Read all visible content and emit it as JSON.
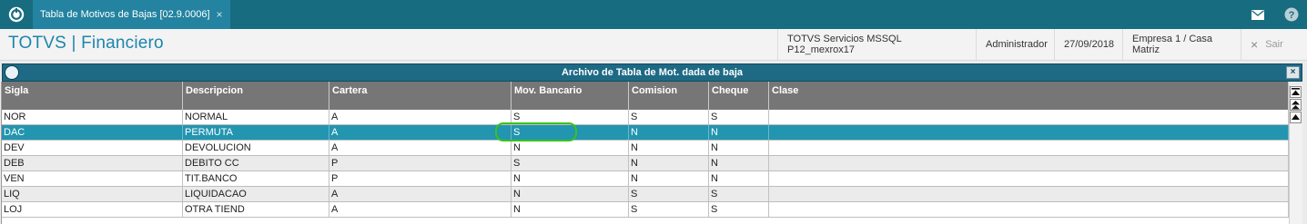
{
  "topbar": {
    "tab_label": "Tabla de Motivos de Bajas [02.9.0006]",
    "tab_close": "×",
    "icons": [
      "app-logo-icon",
      "mail-icon",
      "help-icon"
    ]
  },
  "header": {
    "app_title": "TOTVS | Financiero",
    "server": "TOTVS Servicios MSSQL P12_mexrox17",
    "user": "Administrador",
    "date": "27/09/2018",
    "company": "Empresa 1 / Casa Matriz",
    "exit_icon": "×",
    "exit_label": "Sair"
  },
  "dialog": {
    "title": "Archivo de Tabla de Mot. dada de baja",
    "close_label": "×"
  },
  "grid": {
    "columns": [
      "Sigla",
      "Descripcion",
      "Cartera",
      "Mov. Bancario",
      "Comision",
      "Cheque",
      "Clase"
    ],
    "rows": [
      {
        "cells": [
          "NOR",
          "NORMAL",
          "A",
          "S",
          "S",
          "S",
          ""
        ]
      },
      {
        "cells": [
          "DAC",
          "PERMUTA",
          "A",
          "S",
          "N",
          "N",
          ""
        ]
      },
      {
        "cells": [
          "DEV",
          "DEVOLUCION",
          "A",
          "N",
          "N",
          "N",
          ""
        ]
      },
      {
        "cells": [
          "DEB",
          "DEBITO CC",
          "P",
          "S",
          "N",
          "N",
          ""
        ]
      },
      {
        "cells": [
          "VEN",
          "TIT.BANCO",
          "P",
          "N",
          "N",
          "N",
          ""
        ]
      },
      {
        "cells": [
          "LIQ",
          "LIQUIDACAO",
          "A",
          "N",
          "S",
          "S",
          ""
        ]
      },
      {
        "cells": [
          "LOJ",
          "OTRA TIEND",
          "A",
          "N",
          "S",
          "S",
          ""
        ]
      }
    ],
    "selected_row": 1
  },
  "colors": {
    "topbar": "#176c80",
    "tab": "#2383a0",
    "title_blue": "#1c86ac",
    "dialog_title": "#1e6a85",
    "grid_header": "#767676",
    "selected_row": "#2295b0",
    "highlight_ring": "#37c41c"
  }
}
